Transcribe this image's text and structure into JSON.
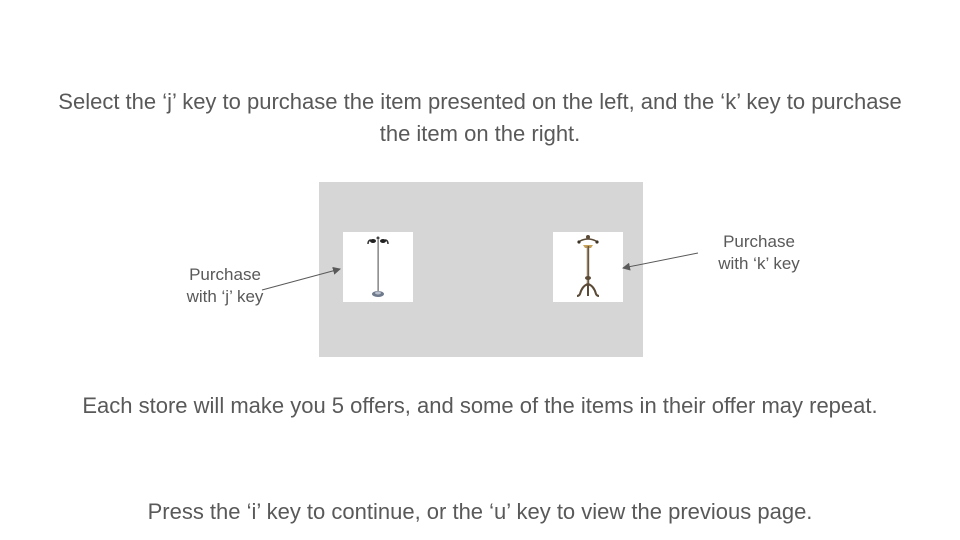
{
  "instructions": {
    "top": "Select the ‘j’ key to purchase the item presented on the left, and the ‘k’ key to purchase the item on the right.",
    "middle": "Each store will make you 5 offers, and some of the items in their offer may repeat.",
    "bottom": "Press the ‘i’ key to continue, or the ‘u’ key to view the previous page."
  },
  "offer": {
    "left_item": {
      "icon": "coat-rack-chrome-icon",
      "key": "j"
    },
    "right_item": {
      "icon": "coat-rack-bronze-icon",
      "key": "k"
    },
    "left_callout": [
      "Purchase",
      "with ‘j’ key"
    ],
    "right_callout": [
      "Purchase",
      "with ‘k’ key"
    ]
  },
  "colors": {
    "text": "#595959",
    "panel": "#d6d6d6",
    "arrow": "#595959"
  }
}
